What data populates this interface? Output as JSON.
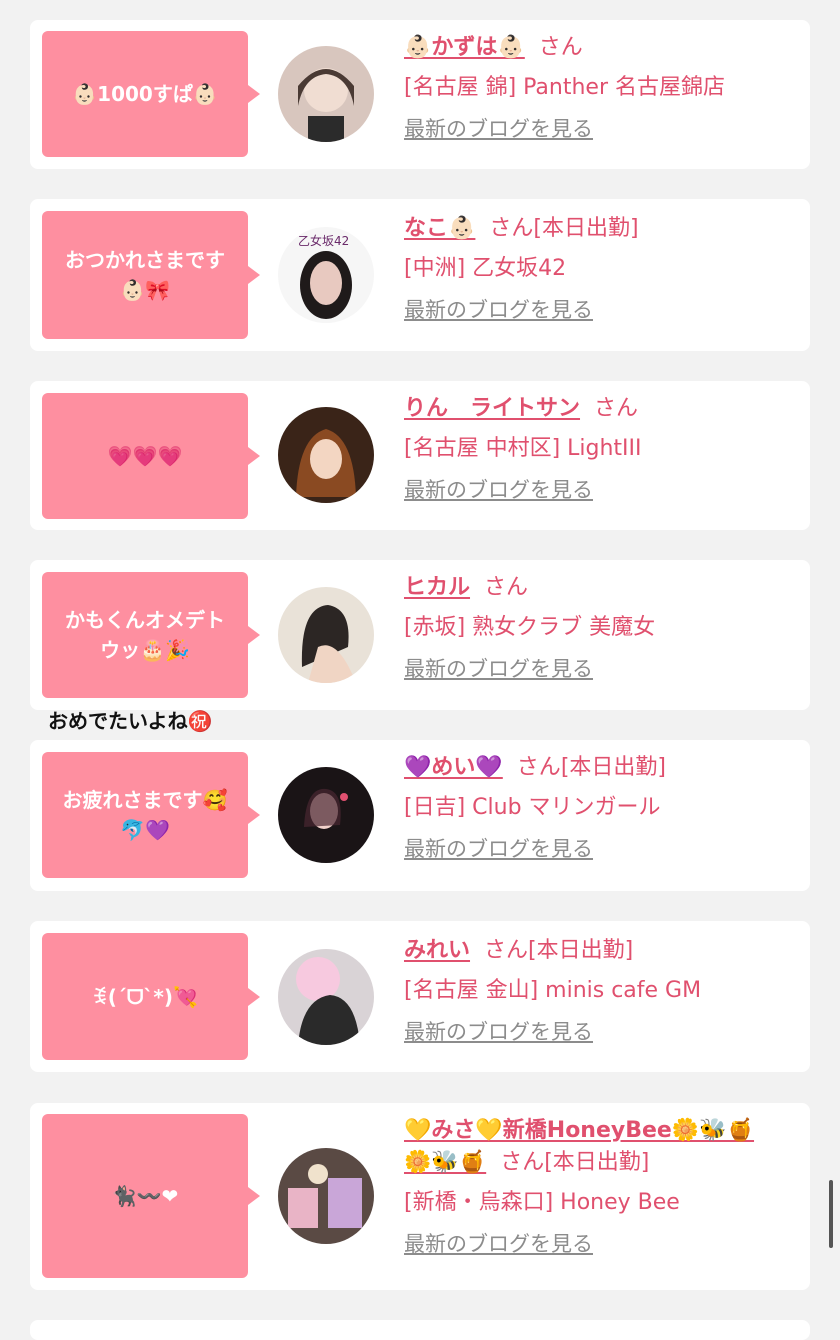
{
  "colors": {
    "accent": "#e0506e",
    "bubble": "#fe8fa0",
    "link_gray": "#8c8c8c",
    "background": "#f2f2f2"
  },
  "cards": [
    {
      "bubble": "👶🏻1000すぱ👶🏻",
      "name": "👶🏻かずは👶🏻",
      "san": "さん",
      "status": "",
      "shop": "[名古屋 錦] Panther 名古屋錦店",
      "blog": "最新のブログを見る"
    },
    {
      "bubble": "おつかれさまです\n👶🏻🎀",
      "name": "なこ👶🏻",
      "san": "さん",
      "status": "[本日出勤]",
      "shop": "[中洲] 乙女坂42",
      "blog": "最新のブログを見る"
    },
    {
      "bubble": "💗💗💗",
      "name": "りん　ライトサン",
      "san": "さん",
      "status": "",
      "shop": "[名古屋 中村区] LightIII",
      "blog": "最新のブログを見る"
    },
    {
      "bubble": "かもくんオメデト\nウッ🎂🎉",
      "name": "ヒカル",
      "san": "さん",
      "status": "",
      "shop": "[赤坂] 熟女クラブ 美魔女",
      "blog": "最新のブログを見る"
    },
    {
      "bubble": "お疲れさまです🥰\n🐬💜",
      "name": "💜めい💜",
      "san": "さん",
      "status": "[本日出勤]",
      "shop": "[日吉] Club マリンガール",
      "blog": "最新のブログを見る"
    },
    {
      "bubble": "ꉂ(ˊᗜˋ*)💘",
      "name": "みれい",
      "san": "さん",
      "status": "[本日出勤]",
      "shop": "[名古屋 金山] minis cafe GM",
      "blog": "最新のブログを見る"
    },
    {
      "bubble": "🐈‍⬛〰️❤",
      "name": "💛みさ💛新橋HoneyBee🌼🐝🍯",
      "name_cont": "🌼🐝🍯",
      "san": "さん",
      "status": "[本日出勤]",
      "shop": "[新橋・烏森口] Honey Bee",
      "blog": "最新のブログを見る"
    }
  ],
  "comment_between": "おめでたいよね㊗️"
}
